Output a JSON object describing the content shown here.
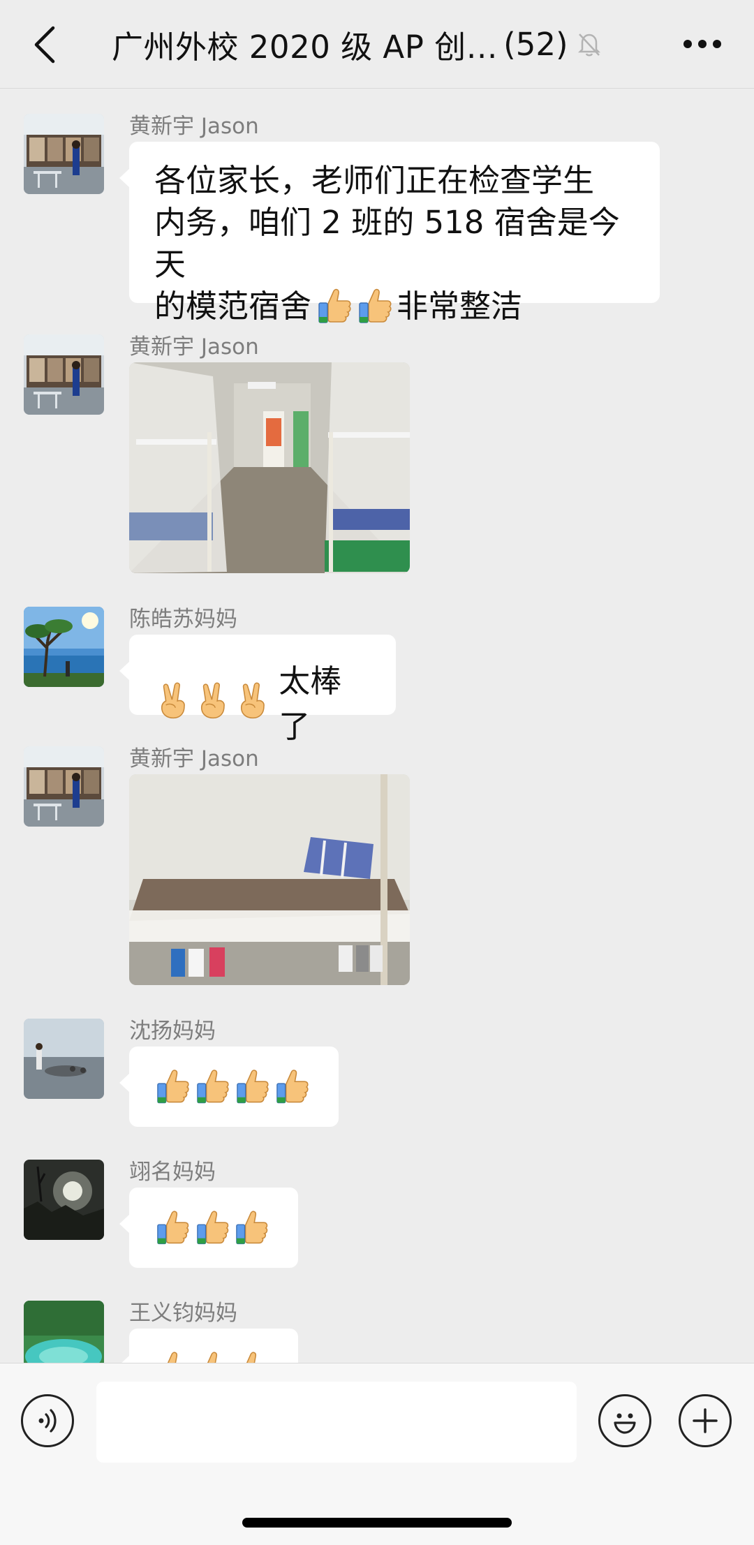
{
  "header": {
    "title": "广州外校 2020 级 AP 创…",
    "member_count": "(52)",
    "back_icon": "chevron-left-icon",
    "mute_icon": "bell-off-icon",
    "more_icon": "more-dots-icon"
  },
  "messages": [
    {
      "sender": "黄新宇 Jason",
      "type": "text",
      "text_line1": "各位家长，老师们正在检查学生",
      "text_line2": "内务，咱们 2 班的 518 宿舍是今天",
      "text_line3": "的模范宿舍",
      "text_tail": "非常整洁",
      "emojis": [
        "thumbs-up",
        "thumbs-up"
      ]
    },
    {
      "sender": "黄新宇 Jason",
      "type": "image",
      "image": "dormitory-room-photo"
    },
    {
      "sender": "陈皓苏妈妈",
      "type": "text",
      "emojis": [
        "victory-hand",
        "victory-hand",
        "victory-hand"
      ],
      "text": "太棒了"
    },
    {
      "sender": "黄新宇 Jason",
      "type": "image",
      "image": "bunk-bed-photo"
    },
    {
      "sender": "沈扬妈妈",
      "type": "emoji",
      "emojis": [
        "thumbs-up",
        "thumbs-up",
        "thumbs-up",
        "thumbs-up"
      ]
    },
    {
      "sender": "翊名妈妈",
      "type": "emoji",
      "emojis": [
        "thumbs-up",
        "thumbs-up",
        "thumbs-up"
      ]
    },
    {
      "sender": "王义钧妈妈",
      "type": "emoji",
      "emojis": [
        "thumbs-up",
        "thumbs-up",
        "thumbs-up"
      ]
    }
  ],
  "input_bar": {
    "voice_icon": "voice-icon",
    "emoji_icon": "smiley-icon",
    "plus_icon": "plus-icon",
    "placeholder": ""
  }
}
